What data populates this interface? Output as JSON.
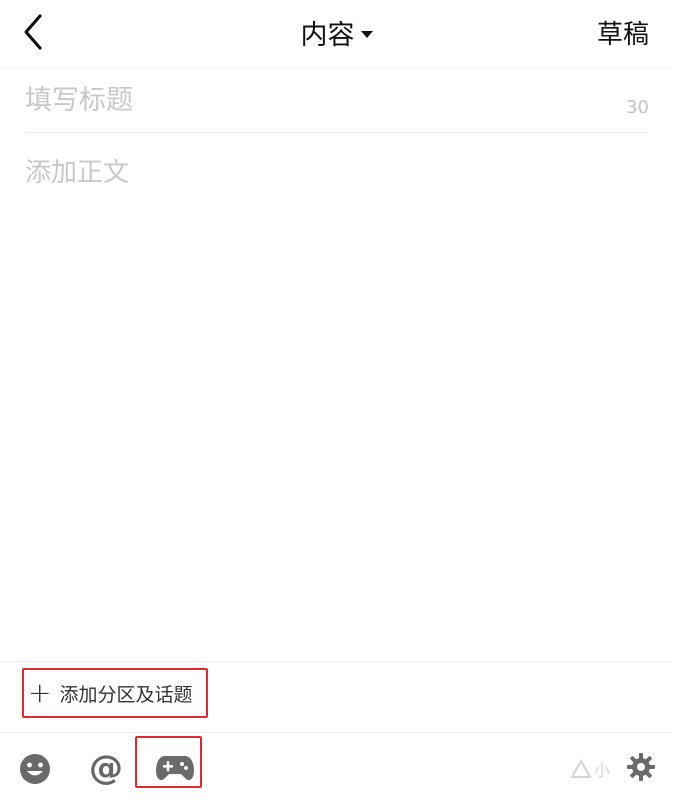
{
  "header": {
    "title": "内容",
    "draft_label": "草稿"
  },
  "editor": {
    "title_placeholder": "填写标题",
    "title_counter": "30",
    "body_placeholder": "添加正文"
  },
  "topic_bar": {
    "add_label": "添加分区及话题",
    "plus_glyph": "+"
  },
  "toolbar": {
    "at_glyph": "@",
    "icons": [
      "emoji-icon",
      "at-icon",
      "gamepad-icon",
      "gear-icon"
    ]
  },
  "watermark": {
    "text": "小"
  },
  "colors": {
    "accent_highlight": "#e0282e",
    "icon_gray": "#666666",
    "placeholder": "#c8c8c8"
  }
}
